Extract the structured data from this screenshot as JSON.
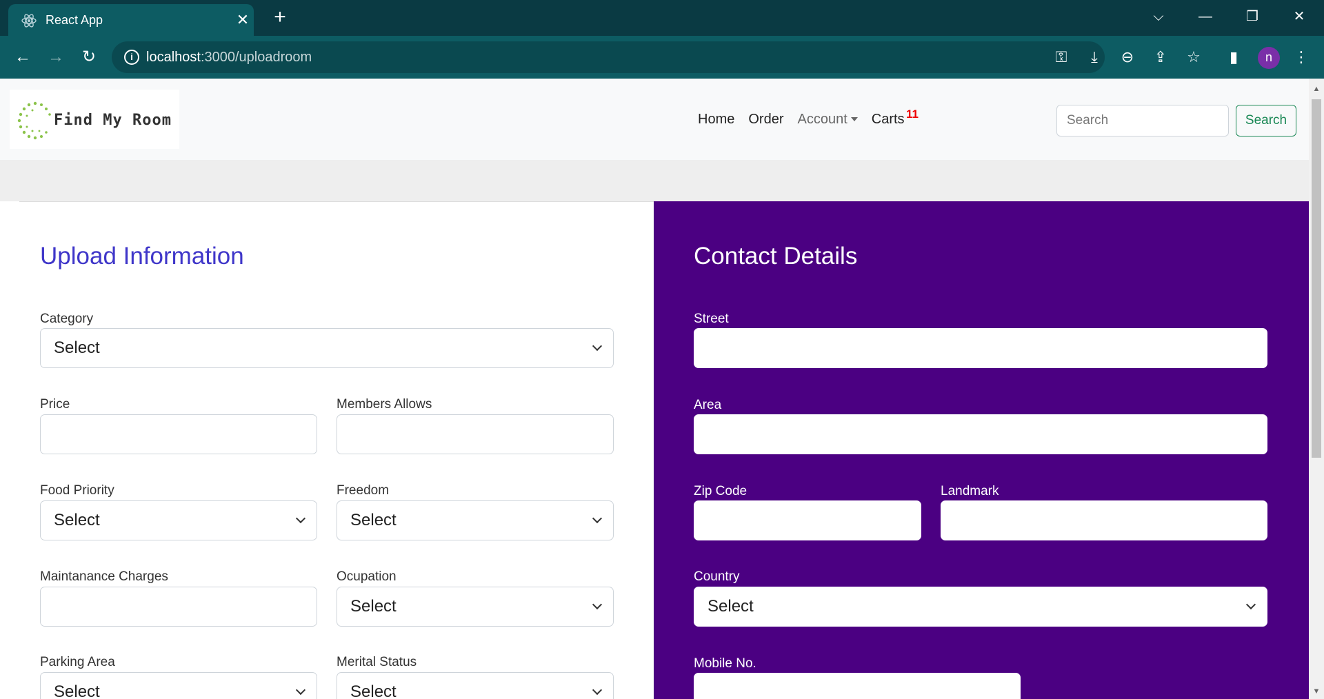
{
  "browser": {
    "tab_title": "React App",
    "url_host": "localhost",
    "url_path": ":3000/uploadroom",
    "profile_initial": "n"
  },
  "navbar": {
    "brand": "Find My Room",
    "links": {
      "home": "Home",
      "order": "Order",
      "account": "Account",
      "carts": "Carts"
    },
    "cart_count": "11",
    "search_placeholder": "Search",
    "search_button": "Search"
  },
  "upload": {
    "title": "Upload Information",
    "category_label": "Category",
    "category_value": "Select",
    "price_label": "Price",
    "members_label": "Members Allows",
    "food_label": "Food Priority",
    "food_value": "Select",
    "freedom_label": "Freedom",
    "freedom_value": "Select",
    "maintenance_label": "Maintanance Charges",
    "occupation_label": "Ocupation",
    "occupation_value": "Select",
    "parking_label": "Parking Area",
    "parking_value": "Select",
    "marital_label": "Merital Status",
    "marital_value": "Select"
  },
  "contact": {
    "title": "Contact Details",
    "street_label": "Street",
    "area_label": "Area",
    "zip_label": "Zip Code",
    "landmark_label": "Landmark",
    "country_label": "Country",
    "country_value": "Select",
    "mobile_label": "Mobile No."
  },
  "colors": {
    "contact_panel": "#4b0082",
    "upload_title": "#3f36c9",
    "browser_frame": "#0d5c63"
  }
}
